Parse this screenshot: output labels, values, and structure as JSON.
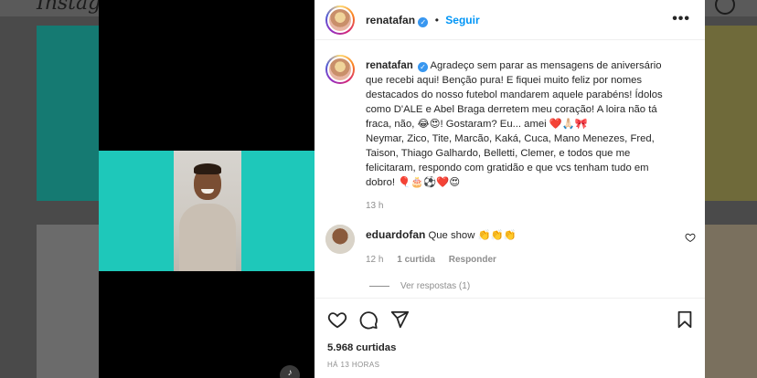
{
  "background": {
    "logo": "Instagram"
  },
  "post": {
    "author": "renatafan",
    "follow_label": "Seguir",
    "separator": "•",
    "more_label": "•••",
    "caption_lines": [
      "Agradeço sem parar as mensagens de aniversário",
      "que recebi aqui! Benção pura! E fiquei muito feliz por nomes",
      "destacados do nosso futebol mandarem aquele parabéns! Ídolos",
      "como D'ALE e Abel Braga derretem meu coração! A loira não tá",
      "fraca, não, 😂😍! Gostaram? Eu... amei ❤️🙏🏻🎀",
      "Neymar, Zico, Tite, Marcão, Kaká, Cuca, Mano Menezes, Fred,",
      "Taison, Thiago Galhardo, Belletti, Clemer, e todos que me",
      "felicitaram, respondo com gratidão e que vcs tenham tudo em",
      "dobro! 🎈🎂⚽❤️😍"
    ],
    "caption_time": "13 h",
    "comment": {
      "author": "eduardofan",
      "text": "Que show 👏👏👏",
      "time": "12 h",
      "likes": "1 curtida",
      "reply_label": "Responder",
      "view_replies": "Ver respostas (1)"
    },
    "likes_count": "5.968 curtidas",
    "date": "HÁ 13 HORAS"
  },
  "colors": {
    "accent": "#0095f6",
    "verified": "#3897f0",
    "teal": "#1ec8ba"
  }
}
